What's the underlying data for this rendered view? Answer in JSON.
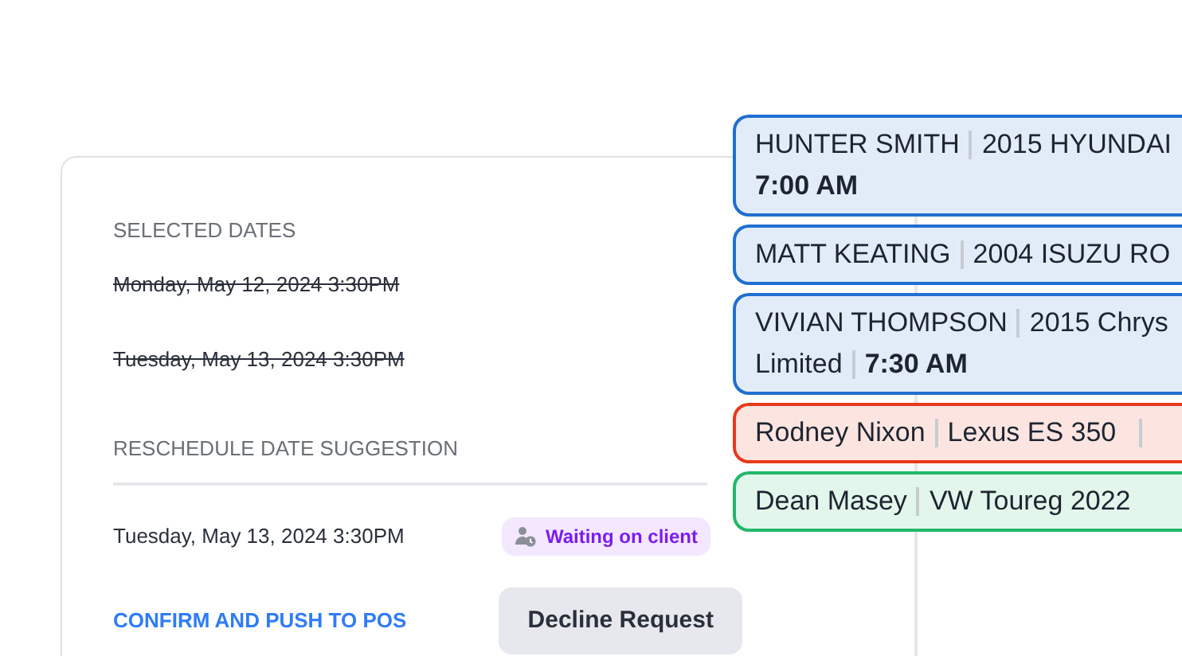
{
  "selected_dates": {
    "heading": "SELECTED DATES",
    "dates": [
      {
        "text": "Monday, May 12, 2024 3:30PM",
        "struck": true
      },
      {
        "text": "Tuesday, May 13, 2024 3:30PM",
        "struck": true
      }
    ]
  },
  "suggestion": {
    "heading": "RESCHEDULE DATE SUGGESTION",
    "date": "Tuesday, May 13, 2024 3:30PM",
    "status": "Waiting on client"
  },
  "actions": {
    "confirm": "CONFIRM AND PUSH TO POS",
    "decline": "Decline Request"
  },
  "appointments": [
    {
      "color": "#1f6fd1",
      "lines": [
        [
          {
            "text": "HUNTER SMITH",
            "bold": false
          },
          {
            "text": "2015 HYUNDAI",
            "bold": false
          }
        ],
        [
          {
            "text": "7:00 AM",
            "bold": true
          }
        ]
      ],
      "trailing_separator": false
    },
    {
      "color": "#1f6fd1",
      "lines": [
        [
          {
            "text": "MATT KEATING",
            "bold": false
          },
          {
            "text": "2004 ISUZU RO",
            "bold": false
          }
        ]
      ],
      "trailing_separator": false
    },
    {
      "color": "#1f6fd1",
      "lines": [
        [
          {
            "text": "VIVIAN THOMPSON",
            "bold": false
          },
          {
            "text": "2015 Chrys",
            "bold": false
          }
        ],
        [
          {
            "text": "Limited",
            "bold": false
          },
          {
            "text": "7:30 AM",
            "bold": true
          }
        ]
      ],
      "trailing_separator": false
    },
    {
      "color": "#e8391c",
      "lines": [
        [
          {
            "text": "Rodney Nixon",
            "bold": false
          },
          {
            "text": "Lexus ES 350",
            "bold": false
          }
        ]
      ],
      "trailing_separator": true
    },
    {
      "color": "#22b86a",
      "lines": [
        [
          {
            "text": "Dean Masey",
            "bold": false
          },
          {
            "text": "VW Toureg 2022",
            "bold": false
          }
        ]
      ],
      "trailing_separator": false
    }
  ]
}
